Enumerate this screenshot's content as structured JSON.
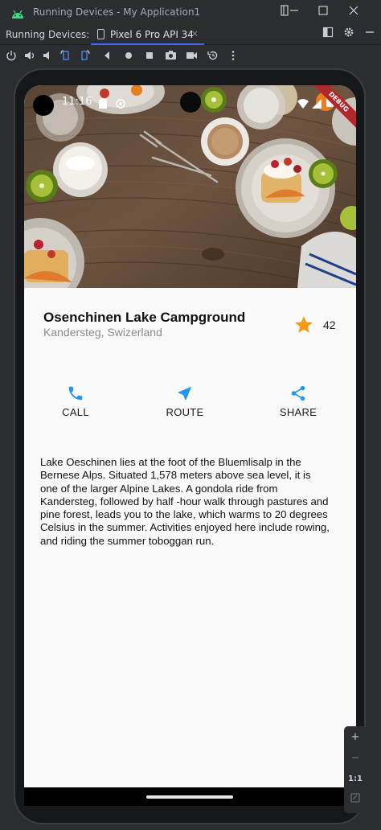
{
  "window": {
    "title": "Running Devices - My Application1"
  },
  "tabs": {
    "label": "Running Devices:",
    "active_tab": "Pixel 6 Pro API 34",
    "close_glyph": "×"
  },
  "device": {
    "status_time": "11:16",
    "debug_banner": "DEBUG"
  },
  "app": {
    "place_name": "Osenchinen Lake Campground",
    "place_location": "Kandersteg, Swizerland",
    "rating": "42",
    "star_color": "#f39c12",
    "action_color": "#2196f3",
    "actions": [
      {
        "label": "CALL",
        "icon": "phone-icon"
      },
      {
        "label": "ROUTE",
        "icon": "navigation-icon"
      },
      {
        "label": "SHARE",
        "icon": "share-icon"
      }
    ],
    "description": "Lake Oeschinen lies at the foot of the Bluemlisalp in the Bernese Alps. Situated 1,578 meters above sea level, it is one of the larger Alpine Lakes. A gondola ride from Kandersteg, followed by half -hour walk through pastures and pine forest, leads you to the lake, which warms to 20 degrees Celsius in the summer. Activities enjoyed here include rowing, and riding the summer toboggan run."
  },
  "zoom": {
    "plus": "+",
    "minus": "−",
    "actual": "1:1"
  }
}
